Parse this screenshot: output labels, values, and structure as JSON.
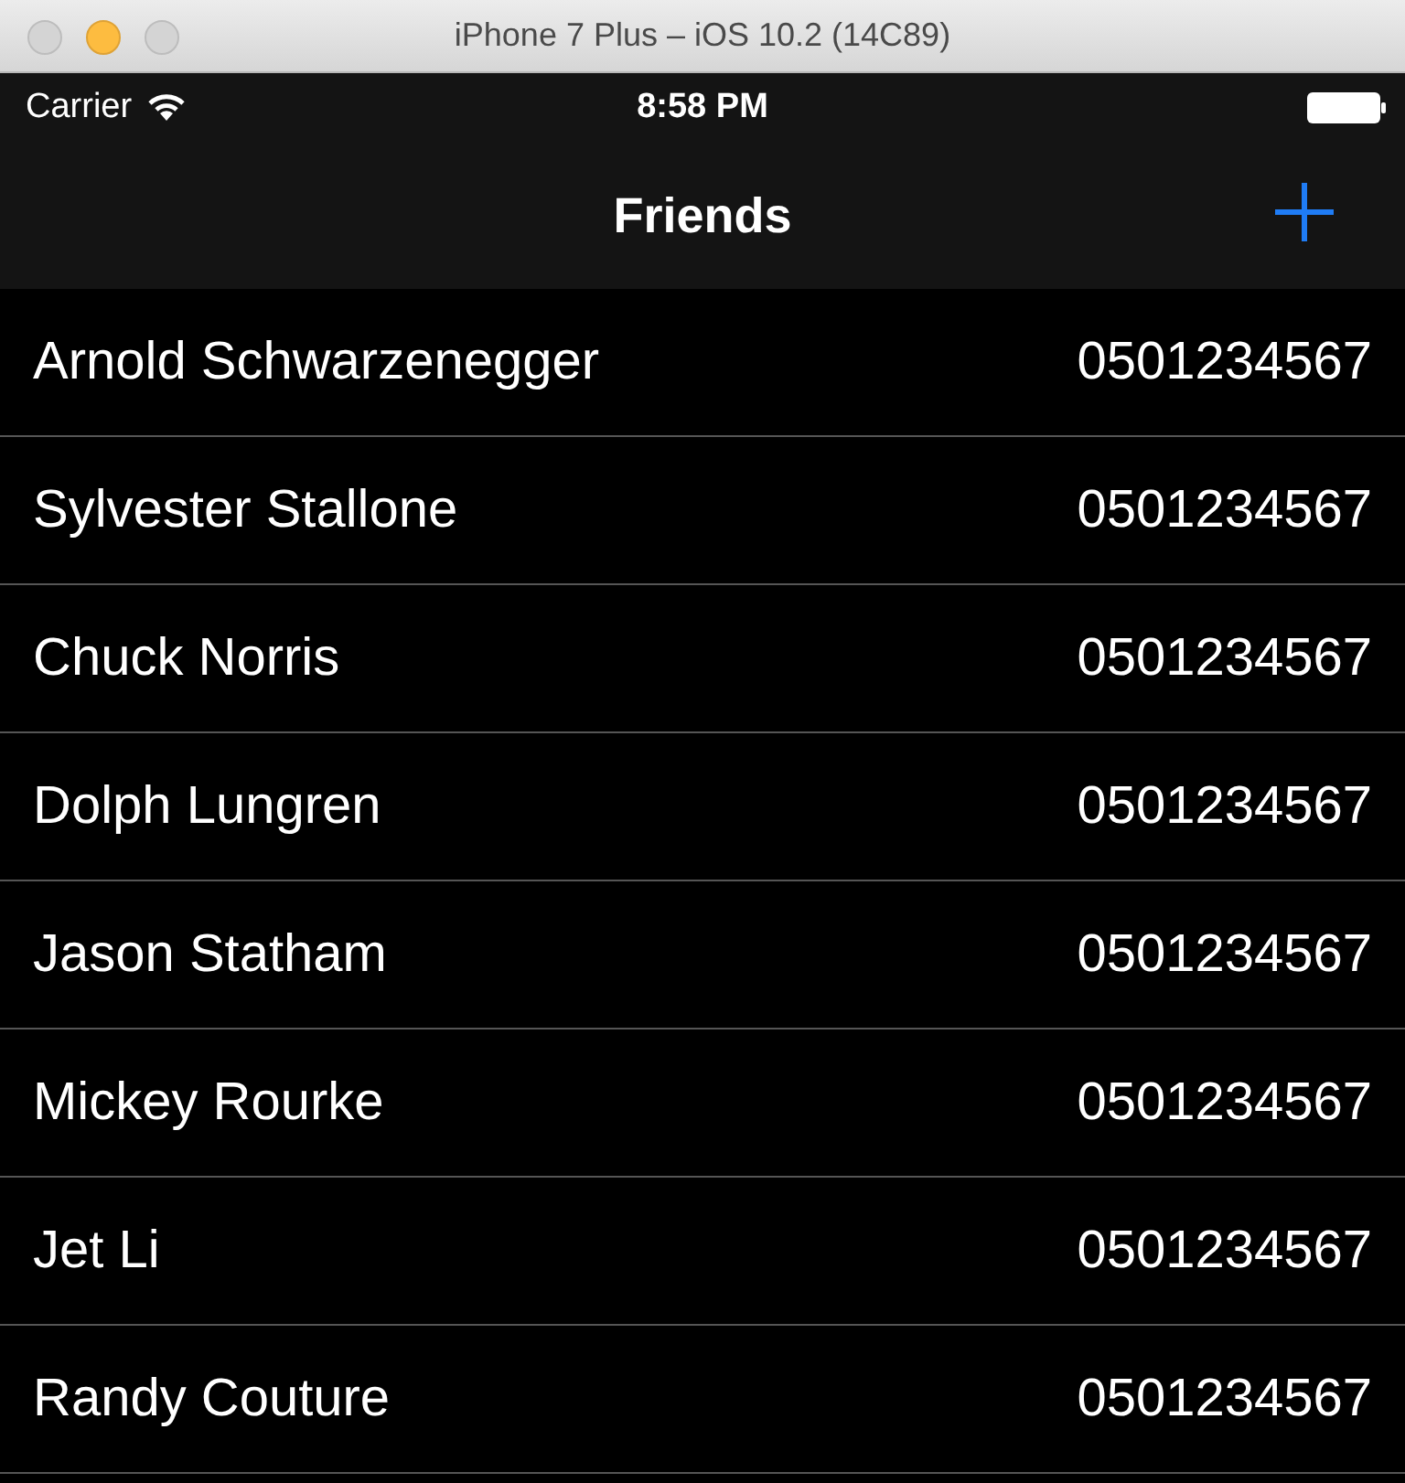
{
  "window": {
    "title": "iPhone 7 Plus – iOS 10.2 (14C89)"
  },
  "status_bar": {
    "carrier": "Carrier",
    "time": "8:58 PM"
  },
  "nav_bar": {
    "title": "Friends"
  },
  "contacts": [
    {
      "name": "Arnold Schwarzenegger",
      "phone": "0501234567"
    },
    {
      "name": "Sylvester Stallone",
      "phone": "0501234567"
    },
    {
      "name": "Chuck Norris",
      "phone": "0501234567"
    },
    {
      "name": "Dolph Lungren",
      "phone": "0501234567"
    },
    {
      "name": "Jason Statham",
      "phone": "0501234567"
    },
    {
      "name": "Mickey Rourke",
      "phone": "0501234567"
    },
    {
      "name": "Jet Li",
      "phone": "0501234567"
    },
    {
      "name": "Randy Couture",
      "phone": "0501234567"
    }
  ]
}
